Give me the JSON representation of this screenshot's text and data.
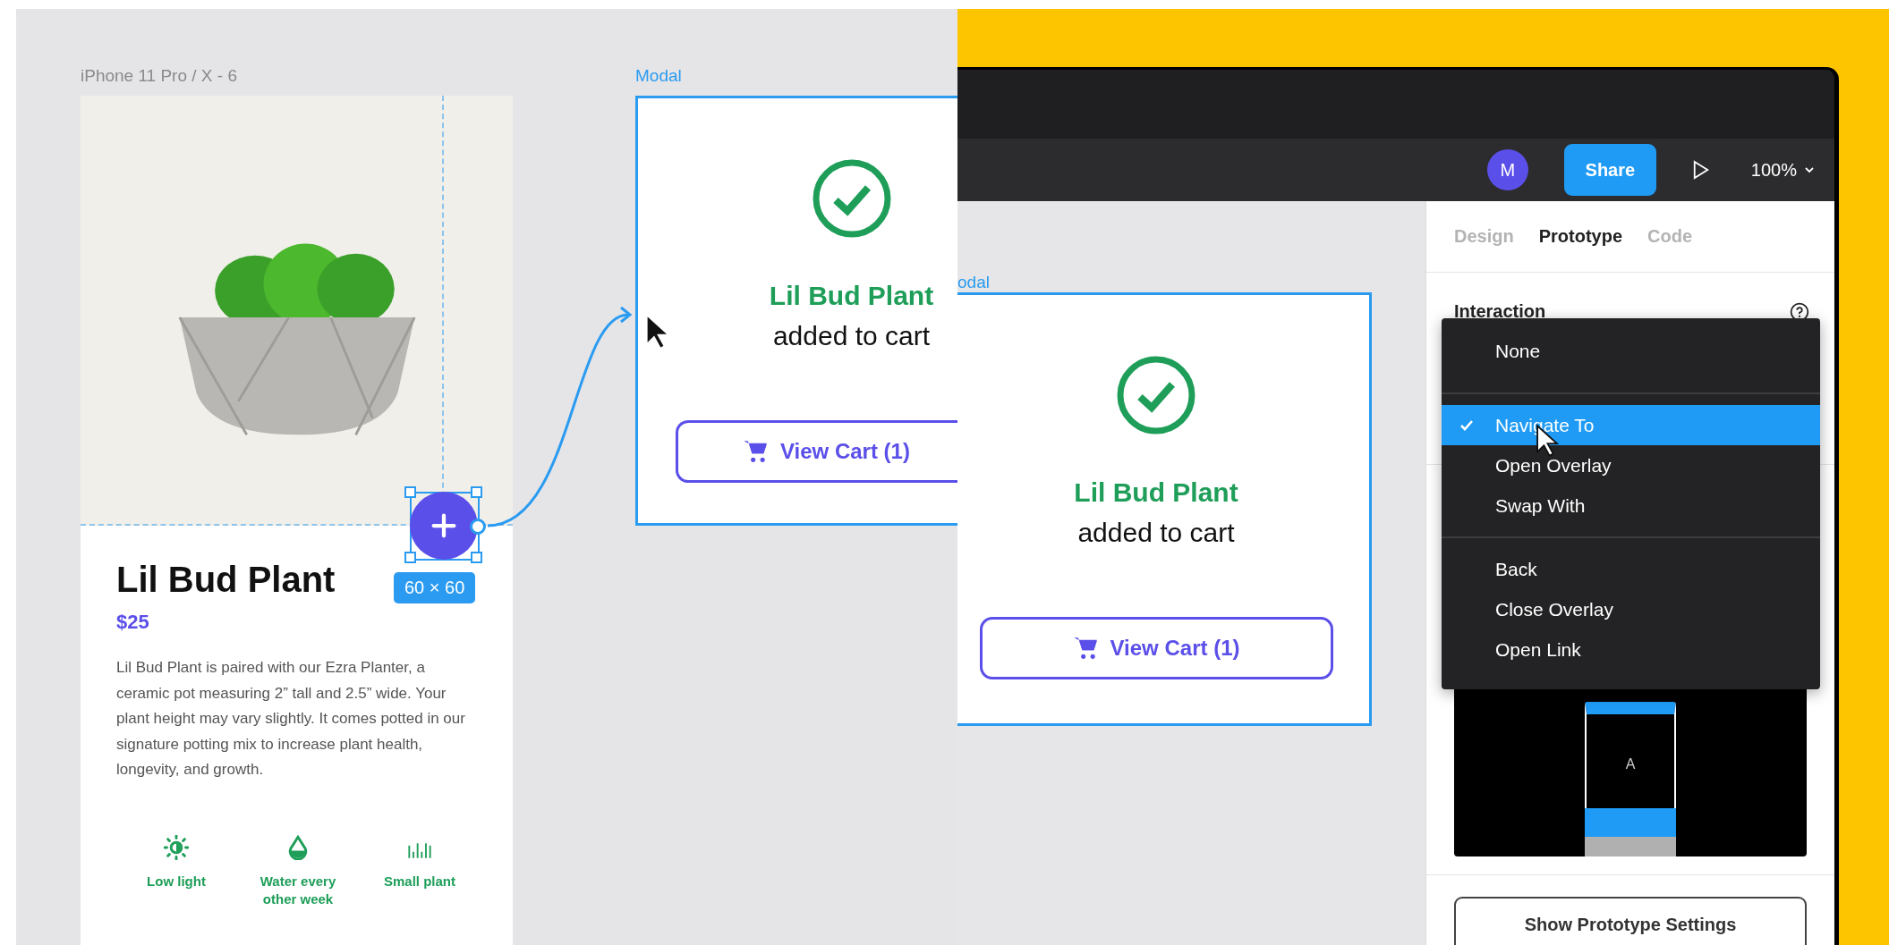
{
  "product_frame": {
    "label": "iPhone 11 Pro / X - 6",
    "title": "Lil Bud Plant",
    "price": "$25",
    "description": "Lil Bud Plant is paired with our Ezra Planter, a ceramic pot measuring 2” tall and 2.5” wide. Your plant height may vary slightly. It comes potted in our signature potting mix to increase plant health, longevity, and growth.",
    "size_badge": "60 × 60",
    "features": [
      {
        "kind": "light",
        "label": "Low light"
      },
      {
        "kind": "water",
        "label": "Water every other week"
      },
      {
        "kind": "size",
        "label": "Small plant"
      }
    ]
  },
  "modal_frame": {
    "label": "Modal",
    "title": "Lil Bud Plant",
    "subtitle": "added to cart",
    "button": "View Cart (1)"
  },
  "editor": {
    "avatar": "M",
    "share": "Share",
    "zoom": "100%",
    "canvas_modal": {
      "label": "odal",
      "title": "Lil Bud Plant",
      "subtitle": "added to cart",
      "button": "View Cart (1)"
    },
    "tabs": [
      {
        "label": "Design",
        "selected": false
      },
      {
        "label": "Prototype",
        "selected": true
      },
      {
        "label": "Code",
        "selected": false
      }
    ],
    "section_title": "Interaction",
    "menu_groups": [
      [
        {
          "label": "None",
          "selected": false
        }
      ],
      [
        {
          "label": "Navigate To",
          "selected": true
        },
        {
          "label": "Open Overlay",
          "selected": false
        },
        {
          "label": "Swap With",
          "selected": false
        }
      ],
      [
        {
          "label": "Back",
          "selected": false
        },
        {
          "label": "Close Overlay",
          "selected": false
        },
        {
          "label": "Open Link",
          "selected": false
        }
      ]
    ],
    "preview_label": "A",
    "settings_button": "Show Prototype Settings"
  }
}
